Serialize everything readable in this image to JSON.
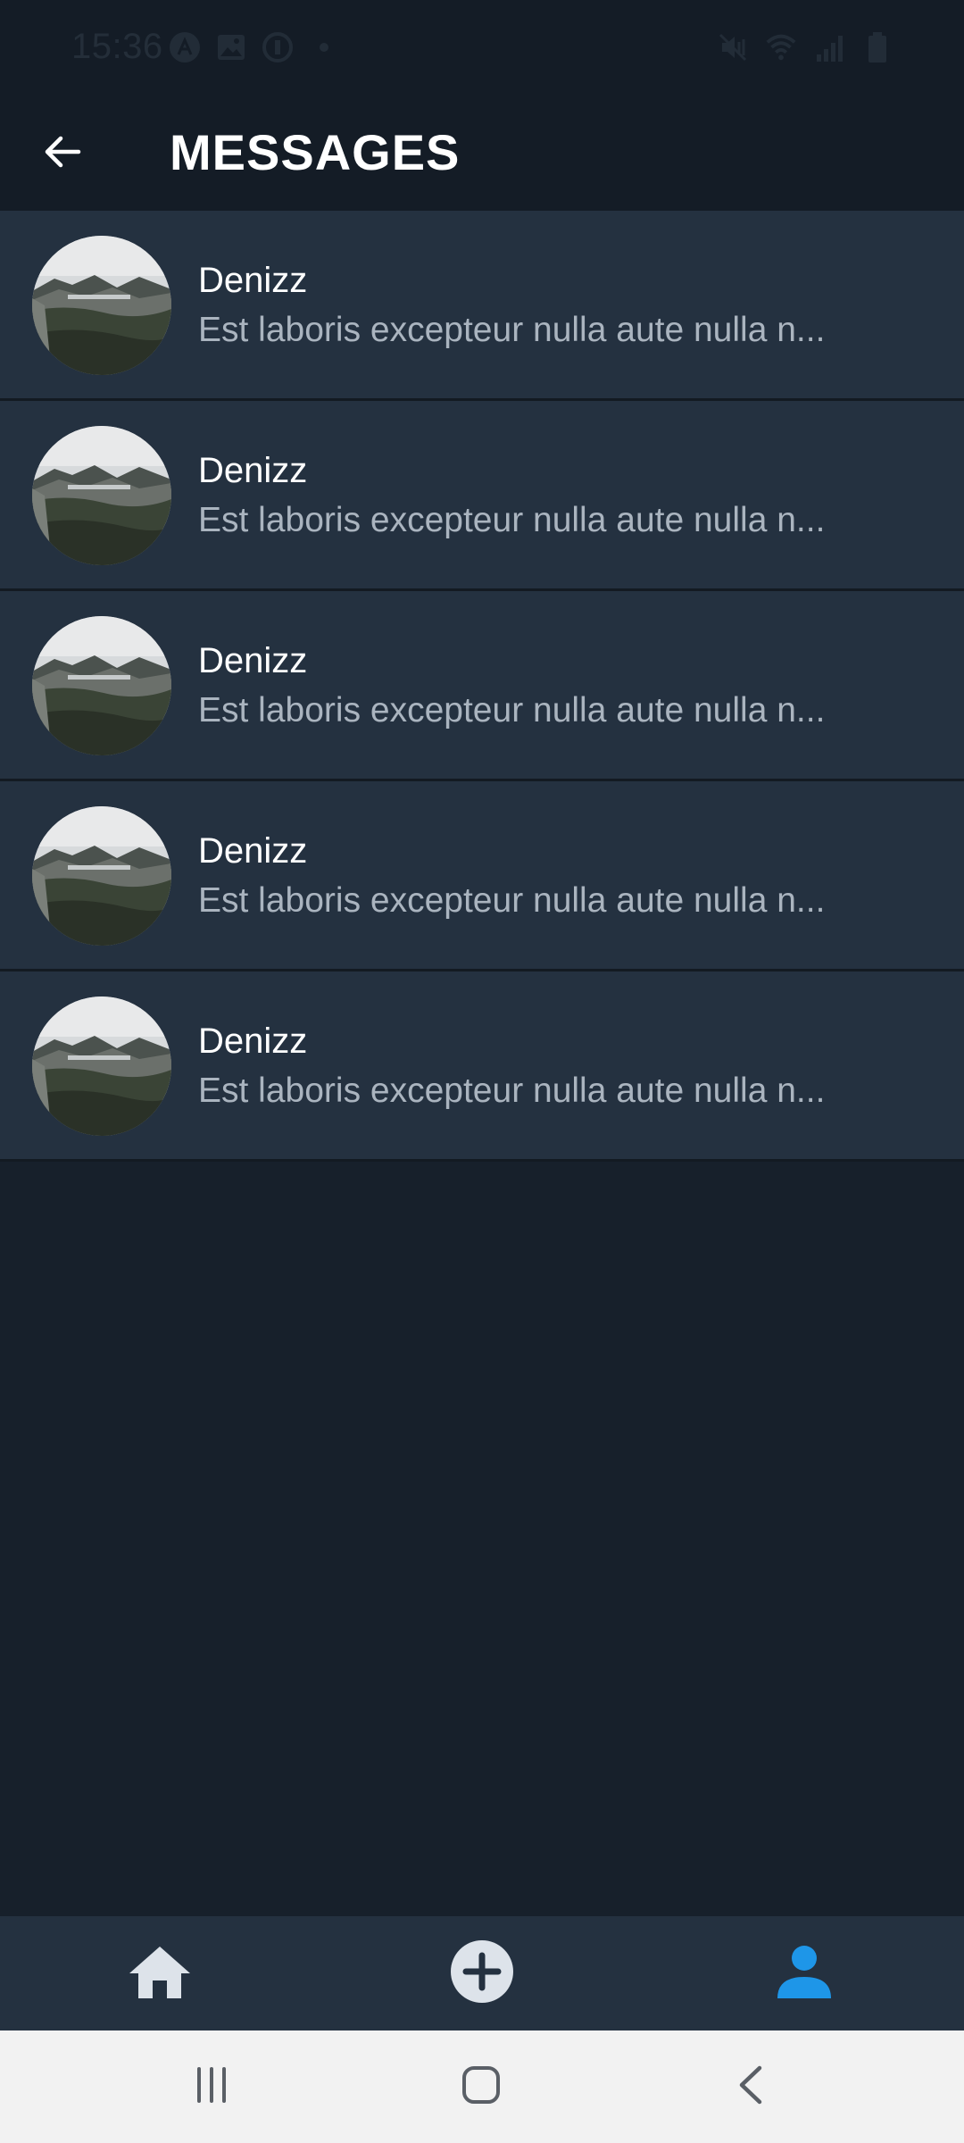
{
  "status_bar": {
    "time": "15:36",
    "left_icons": [
      "app-a-icon",
      "gallery-icon",
      "vpn-icon",
      "dot-icon"
    ],
    "right_icons": [
      "mute-icon",
      "wifi-icon",
      "signal-icon",
      "battery-icon"
    ]
  },
  "header": {
    "title": "MESSAGES",
    "back_icon": "arrow-left-icon"
  },
  "messages": [
    {
      "name": "Denizz",
      "preview": "Est laboris excepteur nulla aute nulla n..."
    },
    {
      "name": "Denizz",
      "preview": "Est laboris excepteur nulla aute nulla n..."
    },
    {
      "name": "Denizz",
      "preview": "Est laboris excepteur nulla aute nulla n..."
    },
    {
      "name": "Denizz",
      "preview": "Est laboris excepteur nulla aute nulla n..."
    },
    {
      "name": "Denizz",
      "preview": "Est laboris excepteur nulla aute nulla n..."
    }
  ],
  "bottom_nav": {
    "items": [
      {
        "icon": "home-icon",
        "active": false
      },
      {
        "icon": "add-circle-icon",
        "active": false
      },
      {
        "icon": "person-icon",
        "active": true
      }
    ]
  },
  "system_nav": {
    "items": [
      "recents-icon",
      "home-square-icon",
      "back-chevron-icon"
    ]
  },
  "colors": {
    "background": "#17202b",
    "header": "#141c26",
    "list_item": "#243140",
    "active_accent": "#1e96e8",
    "preview_text": "#aab4bf"
  }
}
